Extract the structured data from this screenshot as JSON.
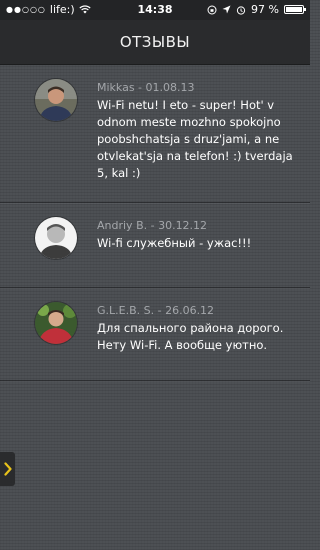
{
  "status_bar": {
    "carrier": "life:)",
    "time": "14:38",
    "battery": "97 %",
    "battery_level": 0.97,
    "icons": [
      "signal-dots-icon",
      "wifi-icon",
      "rotation-lock-icon",
      "location-icon",
      "alarm-icon",
      "battery-icon"
    ]
  },
  "header": {
    "title": "ОТЗЫВЫ"
  },
  "reviews": [
    {
      "author_date": "Mikkas - 01.08.13",
      "text": "Wi-Fi netu! I eto - super! Hot' v odnom meste mozhno spokojno poobshchatsja s druz'jami, a ne otvlekat'sja na telefon! :) tverdaja 5, kal :)"
    },
    {
      "author_date": "Andriy B. - 30.12.12",
      "text": "Wi-fi служебный - ужас!!!"
    },
    {
      "author_date": "G.L.E.B. S. - 26.06.12",
      "text": "Для спального района дорого. Нету Wi-Fi. А вообще уютно."
    }
  ],
  "side_tab": {
    "icon": "chevron-right-icon",
    "accent": "#e8c21a"
  }
}
